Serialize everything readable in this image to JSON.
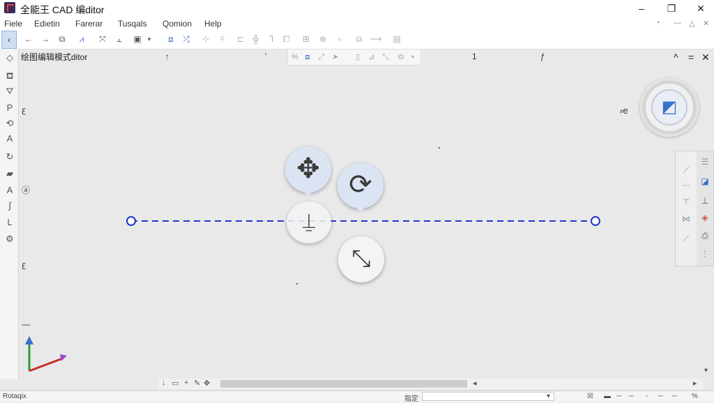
{
  "window": {
    "title": "全能王 CAD 编ditor",
    "minimize": "–",
    "restore": "❐",
    "close": "✕"
  },
  "menubar": {
    "items": [
      "Fiele",
      "Edietin",
      "Farerar",
      "Tusqals",
      "Qomion",
      "Help"
    ],
    "right_icons": [
      "◔",
      "—",
      "△",
      "✕"
    ]
  },
  "toolbar": {
    "collapse_glyph": "‹"
  },
  "drawing": {
    "tab_title": "绘图编辑模式ditor",
    "ruler_marks": [
      "↑",
      "'",
      "1",
      "ƒ"
    ],
    "side_marks": [
      "ꜫ",
      "ⓐ",
      "ꜫ",
      "—"
    ],
    "view_label": "⸗e",
    "panel_controls": [
      "^",
      "=",
      "✕"
    ]
  },
  "gizmo": {
    "move_glyph": "✥",
    "rotate_glyph": "⟳",
    "scale_glyph": "⤡",
    "base_glyph": "⍊"
  },
  "statusbar": {
    "left_text": "Rotaqix",
    "command_label": "指定",
    "command_value": "",
    "right_icons": [
      "☒",
      "▬",
      "─",
      "─",
      "▫",
      "─",
      "─"
    ],
    "percent": "%"
  },
  "colors": {
    "line": "#2233cc",
    "accent": "#3a6fc8",
    "bubble": "#dbe4f2"
  }
}
